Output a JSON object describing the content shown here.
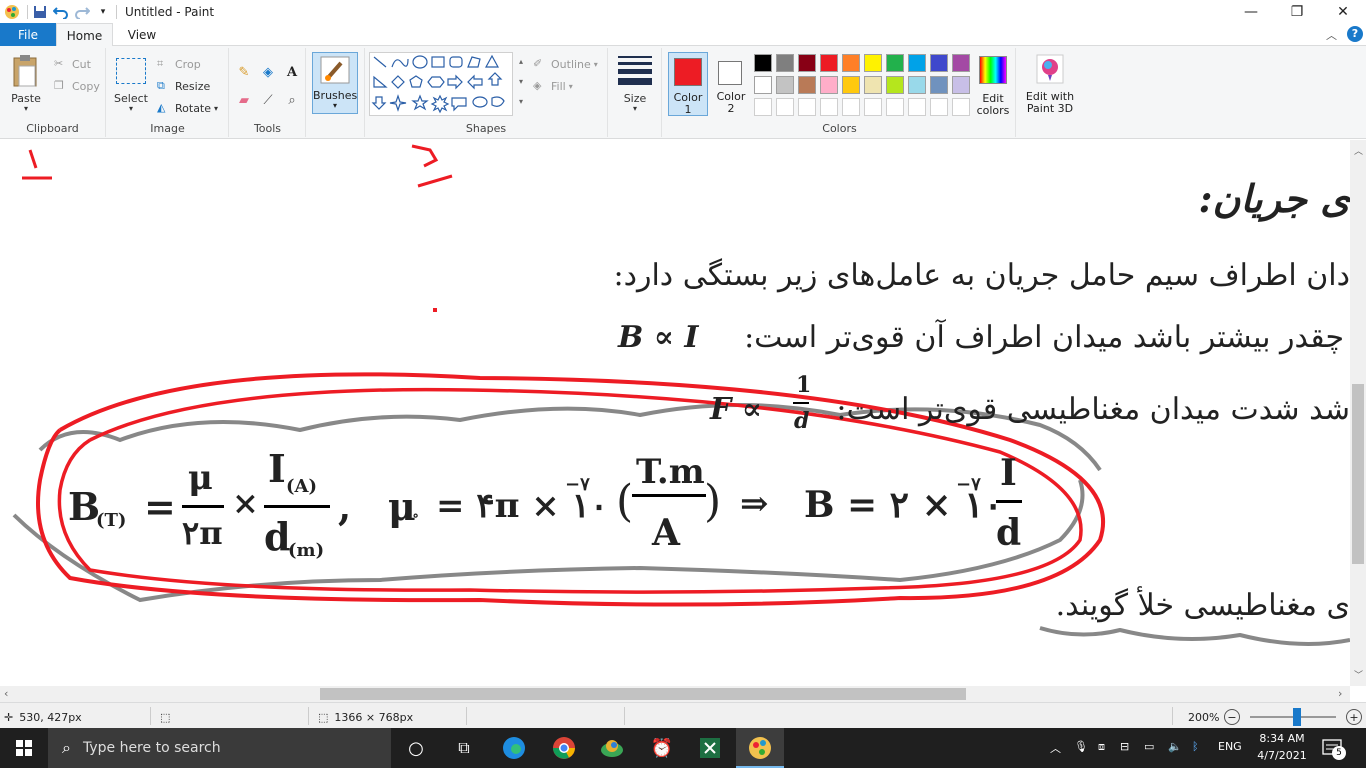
{
  "window": {
    "title": "Untitled - Paint"
  },
  "tabs": {
    "file": "File",
    "home": "Home",
    "view": "View"
  },
  "clipboard": {
    "paste": "Paste",
    "cut": "Cut",
    "copy": "Copy",
    "group": "Clipboard"
  },
  "image": {
    "select": "Select",
    "crop": "Crop",
    "resize": "Resize",
    "rotate": "Rotate",
    "group": "Image"
  },
  "tools": {
    "group": "Tools",
    "brushes": "Brushes"
  },
  "shapes": {
    "group": "Shapes",
    "outline": "Outline",
    "fill": "Fill"
  },
  "size": {
    "label": "Size"
  },
  "colors": {
    "color1": "Color",
    "color1_num": "1",
    "color2": "Color",
    "color2_num": "2",
    "edit": "Edit",
    "edit2": "colors",
    "group": "Colors",
    "edit3d": "Edit with",
    "edit3d2": "Paint 3D",
    "color1_value": "#ed1c24",
    "color2_value": "#ffffff",
    "palette_row1": [
      "#000000",
      "#7f7f7f",
      "#880015",
      "#ed1c24",
      "#ff7f27",
      "#fff200",
      "#22b14c",
      "#00a2e8",
      "#3f48cc",
      "#a349a4"
    ],
    "palette_row2": [
      "#ffffff",
      "#c3c3c3",
      "#b97a57",
      "#ffaec9",
      "#ffc90e",
      "#efe4b0",
      "#b5e61d",
      "#99d9ea",
      "#7092be",
      "#c8bfe7"
    ]
  },
  "canvas": {
    "mark1": "۱",
    "mark2": "۲",
    "line_heading": "ی جریان:",
    "line_1": "دان اطراف سیم حامل جریان به عامل‌های زیر بستگی دارد:",
    "line_2": "چقدر بیشتر باشد میدان اطراف آن قوی‌تر است:",
    "line_2_formula": "B ∝ I",
    "line_3": "شد شدت میدان مغناطیسی قوی‌تر است:",
    "line_3_formula": "F ∝",
    "line_3_num": "1",
    "line_3_den": "d",
    "line_4": "ی مغناطیسی خلأ گویند.",
    "f_B": "B",
    "f_sub_T": "(T)",
    "f_eq": "=",
    "f_mu": "μ",
    "f_2pi": "۲π",
    "f_times": "×",
    "f_I": "I",
    "f_sub_A": "(A)",
    "f_d": "d",
    "f_sub_m": "(m)",
    "f_comma": ",",
    "f_mu0": "μ",
    "f_mu0_sub": "∘",
    "f_4pi": "= ۴π × ۱۰",
    "f_exp": "−۷",
    "f_Tm": "T.m",
    "f_A": "A",
    "f_arrow": "⇒",
    "f_B2": "B = ۲ × ۱۰",
    "f_exp2": "−۷",
    "f_I2": "I",
    "f_d2": "d"
  },
  "status": {
    "coords": "530, 427px",
    "size": "1366 × 768px",
    "zoom": "200%"
  },
  "taskbar": {
    "search": "Type here to search",
    "lang": "ENG",
    "time": "8:34 AM",
    "date": "4/7/2021",
    "notif_count": "5"
  }
}
